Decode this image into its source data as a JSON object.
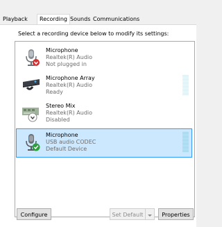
{
  "tabs": [
    {
      "label": "Playback",
      "active": false
    },
    {
      "label": "Recording",
      "active": true
    },
    {
      "label": "Sounds",
      "active": false
    },
    {
      "label": "Communications",
      "active": false
    }
  ],
  "instruction": "Select a recording device below to modify its settings:",
  "devices": [
    {
      "name": "Microphone",
      "driver": "Realtek(R) Audio",
      "status": "Not plugged in",
      "icon": "microphone-unplugged-icon",
      "selected": false
    },
    {
      "name": "Microphone Array",
      "driver": "Realtek(R) Audio",
      "status": "Ready",
      "icon": "microphone-array-icon",
      "selected": false
    },
    {
      "name": "Stereo Mix",
      "driver": "Realtek(R) Audio",
      "status": "Disabled",
      "icon": "stereo-mix-disabled-icon",
      "selected": false
    },
    {
      "name": "Microphone",
      "driver": "USB audio CODEC",
      "status": "Default Device",
      "icon": "microphone-default-icon",
      "selected": true
    }
  ],
  "buttons": {
    "configure": "Configure",
    "set_default": "Set Default",
    "properties": "Properties"
  },
  "colors": {
    "selection_fill": "#cce8ff",
    "selection_border": "#3399ff",
    "default_check": "#2e9e3e",
    "unplugged_badge": "#d32f2f"
  }
}
